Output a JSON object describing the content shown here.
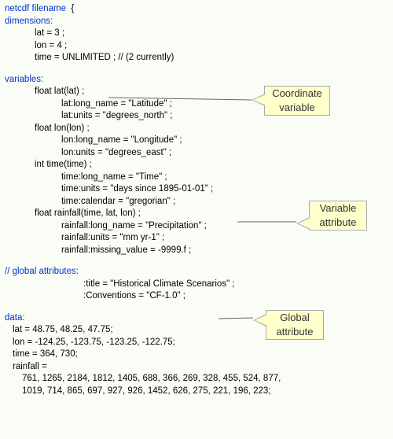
{
  "header": {
    "netcdf_kw": "netcdf",
    "filename": "filename",
    "open": "{"
  },
  "sections": {
    "dimensions_kw": "dimensions:",
    "variables_kw": "variables:",
    "global_attr_kw": "// global attributes:",
    "data_kw": "data:"
  },
  "dimensions": {
    "lat": "lat = 3 ;",
    "lon": "lon = 4 ;",
    "time": "time = UNLIMITED ; // (2 currently)"
  },
  "variables": {
    "lat_decl": "float lat(lat) ;",
    "lat_long_name": "lat:long_name = \"Latitude\" ;",
    "lat_units": "lat:units = \"degrees_north\" ;",
    "lon_decl": "float lon(lon) ;",
    "lon_long_name": "lon:long_name = \"Longitude\" ;",
    "lon_units": "lon:units = \"degrees_east\" ;",
    "time_decl": "int time(time) ;",
    "time_long_name": "time:long_name = \"Time\" ;",
    "time_units": "time:units = \"days since 1895-01-01\" ;",
    "time_calendar": "time:calendar = \"gregorian\" ;",
    "rain_decl": "float rainfall(time, lat, lon) ;",
    "rain_long_name": "rainfall:long_name = \"Precipitation\" ;",
    "rain_units": "rainfall:units = \"mm yr-1\" ;",
    "rain_missing": "rainfall:missing_value = -9999.f ;"
  },
  "global_attrs": {
    "title": ":title = \"Historical Climate Scenarios\" ;",
    "conventions": ":Conventions = \"CF-1.0\" ;"
  },
  "data_block": {
    "lat": "lat = 48.75, 48.25, 47.75;",
    "lon": "lon = -124.25, -123.75, -123.25, -122.75;",
    "time": "time = 364, 730;",
    "rain_head": "rainfall =",
    "rain_line1": "761, 1265, 2184, 1812, 1405, 688, 366, 269, 328, 455, 524, 877,",
    "rain_line2": "1019, 714, 865, 697, 927, 926, 1452, 626, 275, 221, 196, 223;"
  },
  "annotations": {
    "coord_var": "Coordinate\nvariable",
    "var_attr": "Variable\nattribute",
    "global_attr": "Global\nattribute"
  }
}
